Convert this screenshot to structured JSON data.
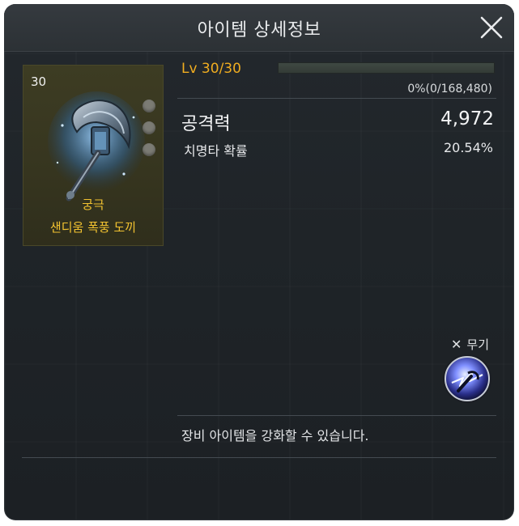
{
  "header": {
    "title": "아이템 상세정보"
  },
  "item": {
    "level_badge": "30",
    "grade": "궁극",
    "name": "샌디움 폭풍 도끼",
    "level": "Lv 30/30",
    "xp_progress": 0,
    "xp_text": "0%(0/168,480)"
  },
  "stats": {
    "main_label": "공격력",
    "main_value": "4,972",
    "sub_label": "치명타 확률",
    "sub_value": "20.54%"
  },
  "requirement": {
    "mark": "✕",
    "label": "무기",
    "icon": "weapon-skill-icon"
  },
  "description": "장비 아이템을 강화할 수 있습니다.",
  "colors": {
    "accent": "#f0ad20",
    "grade": "#f2c230"
  }
}
